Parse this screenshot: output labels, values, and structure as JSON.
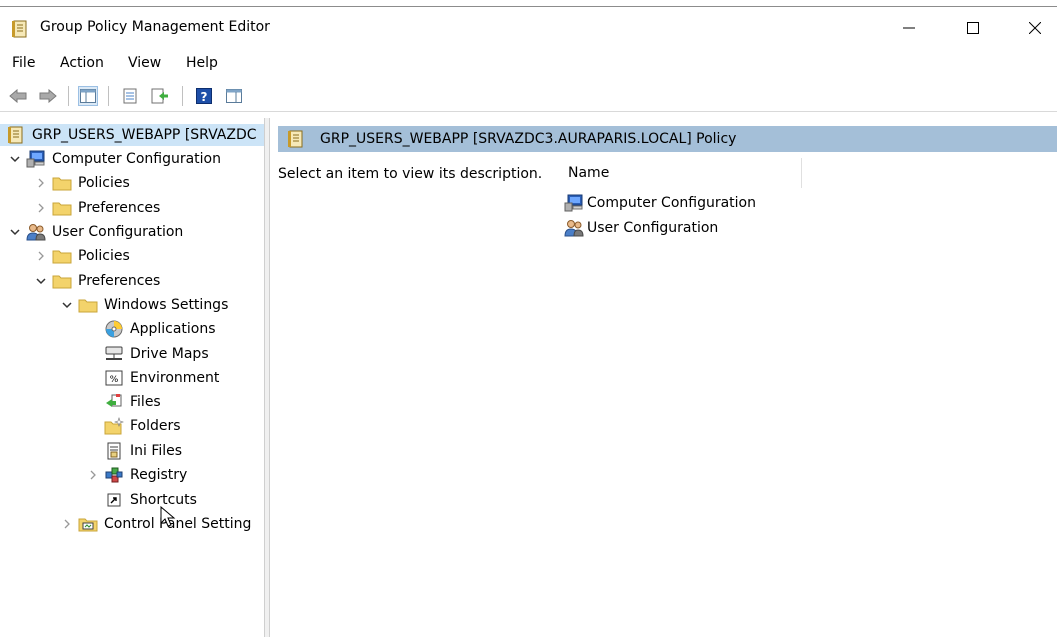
{
  "window": {
    "title": "Group Policy Management Editor",
    "controls": {
      "minimize": "—",
      "maximize": "☐",
      "close": "✕"
    }
  },
  "menu": [
    "File",
    "Action",
    "View",
    "Help"
  ],
  "tree": {
    "root": "GRP_USERS_WEBAPP [SRVAZDC",
    "computer_config": "Computer Configuration",
    "cc_policies": "Policies",
    "cc_preferences": "Preferences",
    "user_config": "User Configuration",
    "uc_policies": "Policies",
    "uc_preferences": "Preferences",
    "windows_settings": "Windows Settings",
    "applications": "Applications",
    "drive_maps": "Drive Maps",
    "environment": "Environment",
    "files": "Files",
    "folders": "Folders",
    "ini_files": "Ini Files",
    "registry": "Registry",
    "shortcuts": "Shortcuts",
    "control_panel": "Control Panel Setting"
  },
  "right": {
    "header": "GRP_USERS_WEBAPP [SRVAZDC3.AURAPARIS.LOCAL] Policy",
    "description": "Select an item to view its description.",
    "column_name": "Name",
    "items": [
      "Computer Configuration",
      "User Configuration"
    ]
  },
  "colors": {
    "selection": "#cce4f7",
    "header_band": "#a4bfd8",
    "folder": "#f3d36b"
  }
}
